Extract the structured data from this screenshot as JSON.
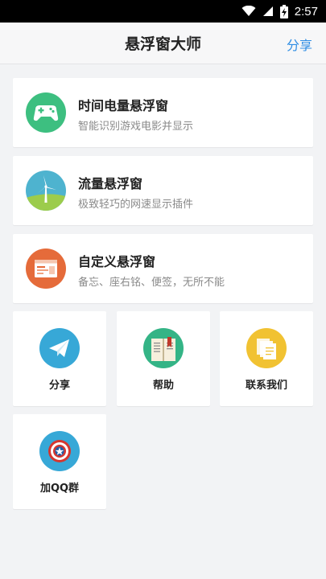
{
  "status_bar": {
    "time": "2:57"
  },
  "header": {
    "title": "悬浮窗大师",
    "share_label": "分享"
  },
  "cards": [
    {
      "title": "时间电量悬浮窗",
      "subtitle": "智能识别游戏电影并显示",
      "icon": "gamepad-icon"
    },
    {
      "title": "流量悬浮窗",
      "subtitle": "极致轻巧的网速显示插件",
      "icon": "windmill-icon"
    },
    {
      "title": "自定义悬浮窗",
      "subtitle": "备忘、座右铭、便签，无所不能",
      "icon": "window-icon"
    }
  ],
  "tiles": [
    {
      "label": "分享",
      "icon": "paper-plane-icon"
    },
    {
      "label": "帮助",
      "icon": "book-icon"
    },
    {
      "label": "联系我们",
      "icon": "documents-icon"
    },
    {
      "label": "加QQ群",
      "icon": "shield-star-icon"
    }
  ],
  "colors": {
    "accent": "#2f8de4",
    "gamepad_bg": "#3dbf80",
    "windmill_bg": "#4eb3cf",
    "window_bg": "#e56b3a",
    "plane_bg": "#37a8d7",
    "book_bg": "#34b486",
    "documents_bg": "#f1c232",
    "shield_bg": "#37a8d7"
  }
}
